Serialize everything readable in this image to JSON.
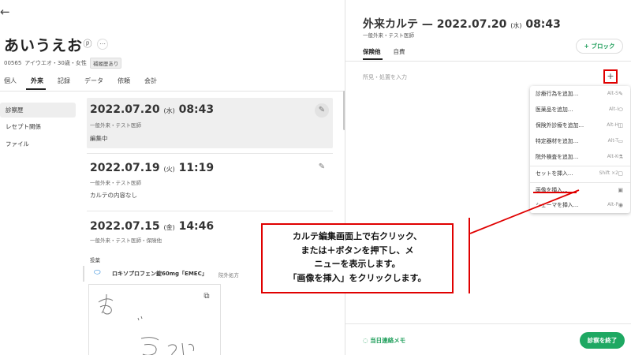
{
  "patient": {
    "name": "あいうえお",
    "id": "00565",
    "kana": "アイウエオ・30歳・女性",
    "badge": "補履歴あり"
  },
  "patient_tabs": [
    "個人",
    "外来",
    "記録",
    "データ",
    "依頼",
    "会計"
  ],
  "sidebar": [
    "診察歴",
    "レセプト関係",
    "ファイル"
  ],
  "visits": [
    {
      "date": "2022.07.20",
      "dow": "(水)",
      "time": "08:43",
      "sub": "一般外来・テスト医師",
      "text": "編集中"
    },
    {
      "date": "2022.07.19",
      "dow": "(火)",
      "time": "11:19",
      "sub": "一般外来・テスト医師",
      "text": "カルテの内容なし"
    },
    {
      "date": "2022.07.15",
      "dow": "(金)",
      "time": "14:46",
      "sub": "一般外来・テスト医師・保険他",
      "text": ""
    }
  ],
  "prescription": {
    "heading": "投薬",
    "drug": "ロキソプロフェン錠60mg「EMEC」",
    "tag": "院外処方"
  },
  "chart": {
    "title": "外来カルテ —",
    "date": "2022.07.20",
    "dow": "(水)",
    "time": "08:43",
    "sub": "一般外来・テスト医師",
    "block_button": "+ ブロック",
    "tabs": [
      "保険他",
      "自費"
    ],
    "finding_placeholder": "所見・処置を入力",
    "plus": "+"
  },
  "menu": [
    {
      "label": "診療行為を追加…",
      "shortcut": "Alt-S",
      "icon": "syringe-icon"
    },
    {
      "label": "医薬品を追加…",
      "shortcut": "Alt-I",
      "icon": "pill-icon"
    },
    {
      "label": "保険外診療を追加…",
      "shortcut": "Alt-H",
      "icon": "bag-icon"
    },
    {
      "label": "特定器材を追加…",
      "shortcut": "Alt-T",
      "icon": "equipment-icon"
    },
    {
      "label": "院外検査を追加…",
      "shortcut": "Alt-K",
      "icon": "flask-icon"
    },
    {
      "label": "セットを挿入…",
      "shortcut": "Shift ×2",
      "icon": "folder-icon"
    },
    {
      "label": "画像を挿入…",
      "shortcut": "",
      "icon": "image-icon"
    },
    {
      "label": "シェーマを挿入…",
      "shortcut": "Alt-P",
      "icon": "palette-icon"
    }
  ],
  "footer": {
    "memo": "当日連絡メモ",
    "end_button": "診察を終了"
  },
  "callout": {
    "lines": [
      "カルテ編集画面上で右クリック、",
      "または＋ボタンを押下し、メ",
      "ニューを表示します。",
      "「画像を挿入」をクリックします。"
    ]
  },
  "colors": {
    "accent_green": "#1ea862",
    "annotation_red": "#e00000",
    "link_blue": "#1a7fd6"
  }
}
